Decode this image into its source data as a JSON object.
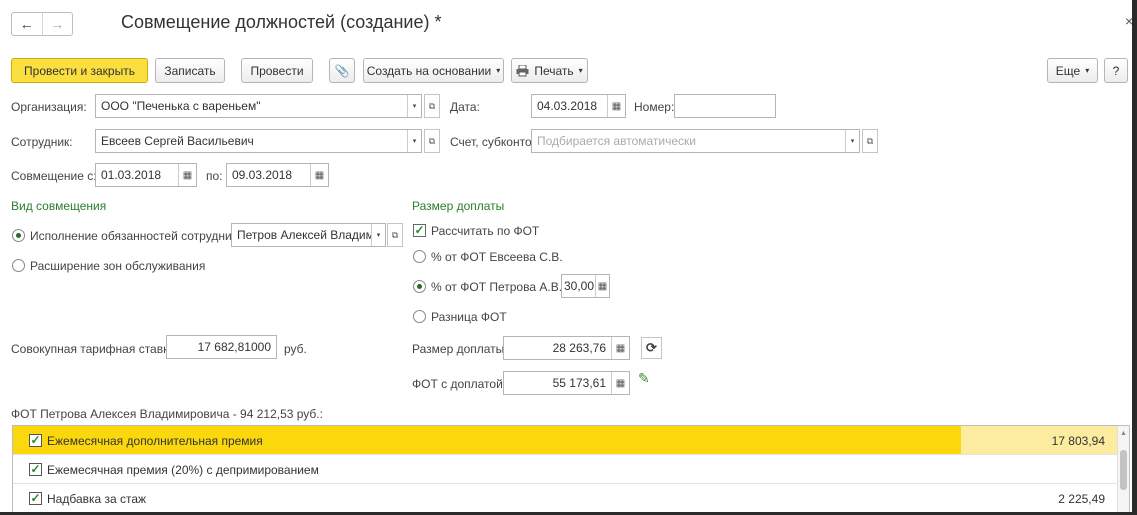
{
  "window": {
    "title": "Совмещение должностей (создание) *",
    "back": "←",
    "forward": "→",
    "close": "×"
  },
  "toolbar": {
    "post_close": "Провести и закрыть",
    "save": "Записать",
    "post": "Провести",
    "attach": "📎",
    "create_based": "Создать на основании",
    "print": "Печать",
    "more": "Еще",
    "help": "?"
  },
  "form": {
    "org_label": "Организация:",
    "org_value": "ООО \"Печенька с вареньем\"",
    "date_label": "Дата:",
    "date_value": "04.03.2018",
    "number_label": "Номер:",
    "number_value": "",
    "employee_label": "Сотрудник:",
    "employee_value": "Евсеев Сергей Васильевич",
    "account_label": "Счет, субконто:",
    "account_placeholder": "Подбирается автоматически",
    "combo_from_label": "Совмещение с:",
    "combo_from": "01.03.2018",
    "combo_to_label": "по:",
    "combo_to": "09.03.2018"
  },
  "combo_type": {
    "heading": "Вид совмещения",
    "opt1": "Исполнение обязанностей сотрудника",
    "opt1_employee": "Петров Алексей Владими",
    "opt2": "Расширение зон обслуживания"
  },
  "surcharge": {
    "heading": "Размер доплаты",
    "calc_fot": "Рассчитать по ФОТ",
    "opt_pct_evseev": "% от ФОТ Евсеева С.В.",
    "opt_pct_petrov": "% от ФОТ Петрова А.В.",
    "pct_value": "30,00",
    "opt_diff": "Разница ФОТ",
    "amount_label": "Размер доплаты:",
    "amount_value": "28 263,76",
    "fot_label": "ФОТ с доплатой:",
    "fot_value": "55 173,61"
  },
  "rate": {
    "label": "Совокупная тарифная ставка:",
    "value": "17 682,81000",
    "unit": "руб."
  },
  "table": {
    "caption": "ФОТ Петрова Алексея Владимировича - 94 212,53 руб.:",
    "rows": [
      {
        "name": "Ежемесячная дополнительная премия",
        "amount": "17 803,94"
      },
      {
        "name": "Ежемесячная премия (20%) с депримированием",
        "amount": ""
      },
      {
        "name": "Надбавка за стаж",
        "amount": "2 225,49"
      }
    ]
  },
  "icons": {
    "dropdown": "▾",
    "calendar": "▦",
    "open": "⧉",
    "check": "✓",
    "refresh": "⟳",
    "pencil": "✎"
  }
}
